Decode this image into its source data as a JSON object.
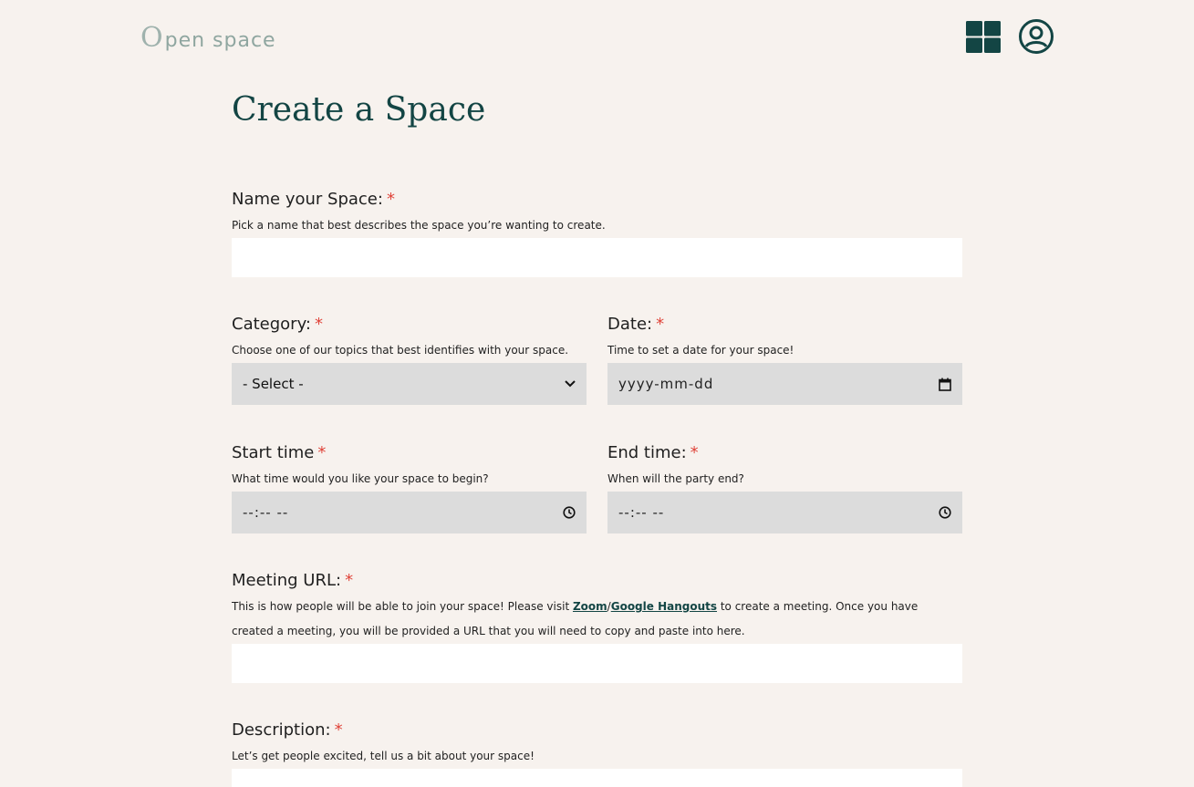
{
  "header": {
    "logo_o": "O",
    "logo_text": "pen space"
  },
  "page": {
    "title": "Create a Space"
  },
  "form": {
    "name": {
      "label": "Name your Space:",
      "required": "*",
      "help": "Pick a name that best describes the space you’re wanting to create.",
      "value": ""
    },
    "category": {
      "label": "Category:",
      "required": "*",
      "help": "Choose one of our topics that best identifies with your space.",
      "selected": "- Select -"
    },
    "date": {
      "label": "Date:",
      "required": "*",
      "help": "Time to set a date for your space!",
      "placeholder": "yyyy-mm-dd"
    },
    "start_time": {
      "label": "Start time",
      "required": "*",
      "help": "What time would you like your space to begin?",
      "placeholder": "--:-- --"
    },
    "end_time": {
      "label": "End time:",
      "required": "*",
      "help": "When will the party end?",
      "placeholder": "--:-- --"
    },
    "meeting_url": {
      "label": "Meeting URL:",
      "required": "*",
      "help_before": "This is how people will be able to join your space! Please visit ",
      "link_zoom": "Zoom",
      "link_sep": "/",
      "link_hangouts": "Google Hangouts",
      "help_after": " to create a meeting. Once you have created a meeting, you will be provided a URL that you will need to copy and paste into here.",
      "value": ""
    },
    "description": {
      "label": "Description:",
      "required": "*",
      "help": "Let’s get people excited, tell us a bit about your space!"
    }
  },
  "colors": {
    "background": "#f7f2ee",
    "brand": "#134544",
    "required": "#e0443a",
    "input_grey": "#dcdcdc"
  }
}
